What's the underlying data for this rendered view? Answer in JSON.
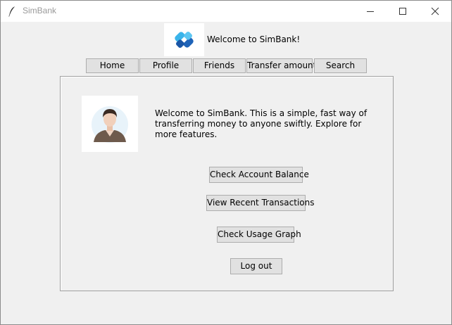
{
  "window": {
    "title": "SimBank",
    "icon": "feather-icon",
    "controls": [
      "minimize-icon",
      "maximize-icon",
      "close-icon"
    ]
  },
  "header": {
    "logo": "simbank-logo",
    "welcome": "Welcome to SimBank!"
  },
  "nav": {
    "items": [
      {
        "label": "Home"
      },
      {
        "label": "Profile"
      },
      {
        "label": "Friends"
      },
      {
        "label": "Transfer amount"
      },
      {
        "label": "Search"
      }
    ]
  },
  "main": {
    "avatar": "user-avatar",
    "intro": "Welcome to SimBank. This is a simple, fast way of transferring money to anyone swiftly. Explore for more features.",
    "buttons": {
      "check_balance": "Check Account Balance",
      "recent_transactions": "View Recent Transactions",
      "usage_graph": "Check Usage Graph",
      "logout": "Log out"
    }
  },
  "colors": {
    "background": "#f0f0f0",
    "button_face": "#e1e1e1",
    "button_border": "#adadad",
    "logo_light_blue": "#3ab4ea",
    "logo_dark_blue": "#1e63b8"
  }
}
